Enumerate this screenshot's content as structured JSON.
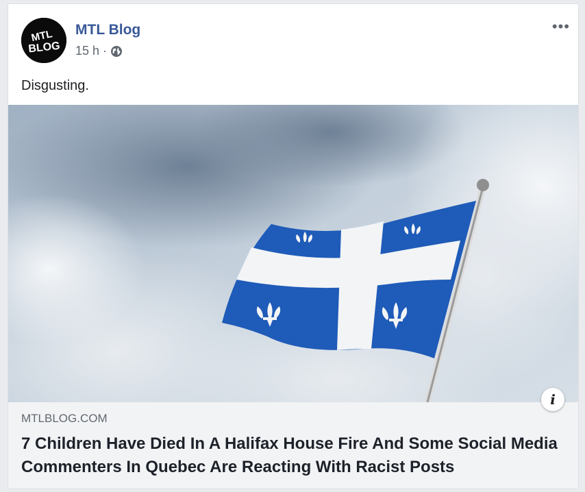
{
  "post": {
    "page_name": "MTL Blog",
    "timestamp": "15 h",
    "separator": "·",
    "privacy_icon": "globe-icon",
    "more_label": "•••",
    "avatar_text": "MTL BLOG",
    "message": "Disgusting."
  },
  "link": {
    "domain": "MTLBLOG.COM",
    "headline": "7 Children Have Died In A Halifax House Fire And Some Social Media Commenters In Quebec Are Reacting With Racist Posts",
    "info_label": "i"
  },
  "colors": {
    "page_name": "#385898",
    "flag_blue": "#1f5bb8",
    "link_bg": "#f2f3f5"
  }
}
